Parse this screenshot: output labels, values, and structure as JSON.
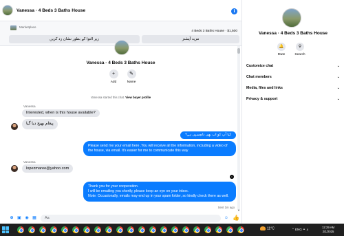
{
  "header": {
    "title": "Vanessa · 4 Beds 3 Baths House"
  },
  "marketplace": {
    "label": "Marketplace",
    "listing": "4 Beds 3 Baths House · $1,500",
    "buttons": [
      "زیر التوا کے بطور نشان زد کریں",
      "مزید آپشنز"
    ]
  },
  "intro": {
    "title": "Vanessa · 4 Beds 3 Baths House",
    "actions": [
      {
        "label": "Add",
        "icon": "add-person-icon"
      },
      {
        "label": "Name",
        "icon": "pencil-icon"
      }
    ],
    "started_text": "Vanessa started this chat.",
    "started_link": "View buyer profile"
  },
  "messages": {
    "sender1": "Vanessa",
    "in1": "Interested, when is this house available?",
    "in2": "پیغام بھیج دیا گیا",
    "out1": "کیا آپ کو اب بھی دلچسپی ہے؟",
    "out2": "Please send me your email here .You will receive all the information, including a video of the house, via email. It's easier for me to communicate this way",
    "sender2": "Vanessa",
    "in3": "lopezmaree@yahoo.com",
    "out3": "Thank you for your cooperation.\nI will be emailing you shortly, please keep an eye on your inbox.\nNote: Occasionally, emails may end up in your spam folder, so kindly check there as well.",
    "sent_label": "Sent 1m ago"
  },
  "composer": {
    "placeholder": "Aa"
  },
  "side": {
    "title": "Vanessa · 4 Beds 3 Baths House",
    "actions": [
      {
        "label": "Mute",
        "icon": "bell-icon"
      },
      {
        "label": "Search",
        "icon": "search-icon"
      }
    ],
    "rows": [
      "Customize chat",
      "Chat members",
      "Media, files and links",
      "Privacy & support"
    ]
  },
  "taskbar": {
    "weather": "11°C",
    "lang": "ENG",
    "time": "12:29 AM",
    "date": "2/1/2025"
  },
  "colors": {
    "accent": "#0a7cff",
    "bubble_in": "#e4e6eb",
    "taskbar": "#1f1f1f"
  }
}
